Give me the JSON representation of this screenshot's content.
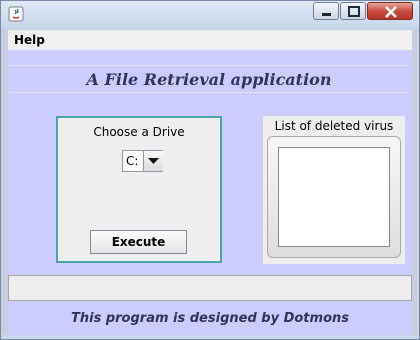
{
  "menu": {
    "help_label": "Help"
  },
  "app": {
    "title": "A File Retrieval application",
    "footer": "This program is designed by Dotmons"
  },
  "drive_panel": {
    "label": "Choose a Drive",
    "selected_drive": "C:",
    "execute_label": "Execute"
  },
  "virus_panel": {
    "label": "List of deleted virus",
    "items": []
  },
  "status": {
    "text": ""
  },
  "icons": {
    "app": "java-icon",
    "minimize": "minimize-icon",
    "maximize": "maximize-icon",
    "close": "close-icon",
    "dropdown": "chevron-down-icon"
  },
  "colors": {
    "background": "#ccccff",
    "panel_border": "#4aa6a6",
    "close_button": "#c7483a"
  }
}
